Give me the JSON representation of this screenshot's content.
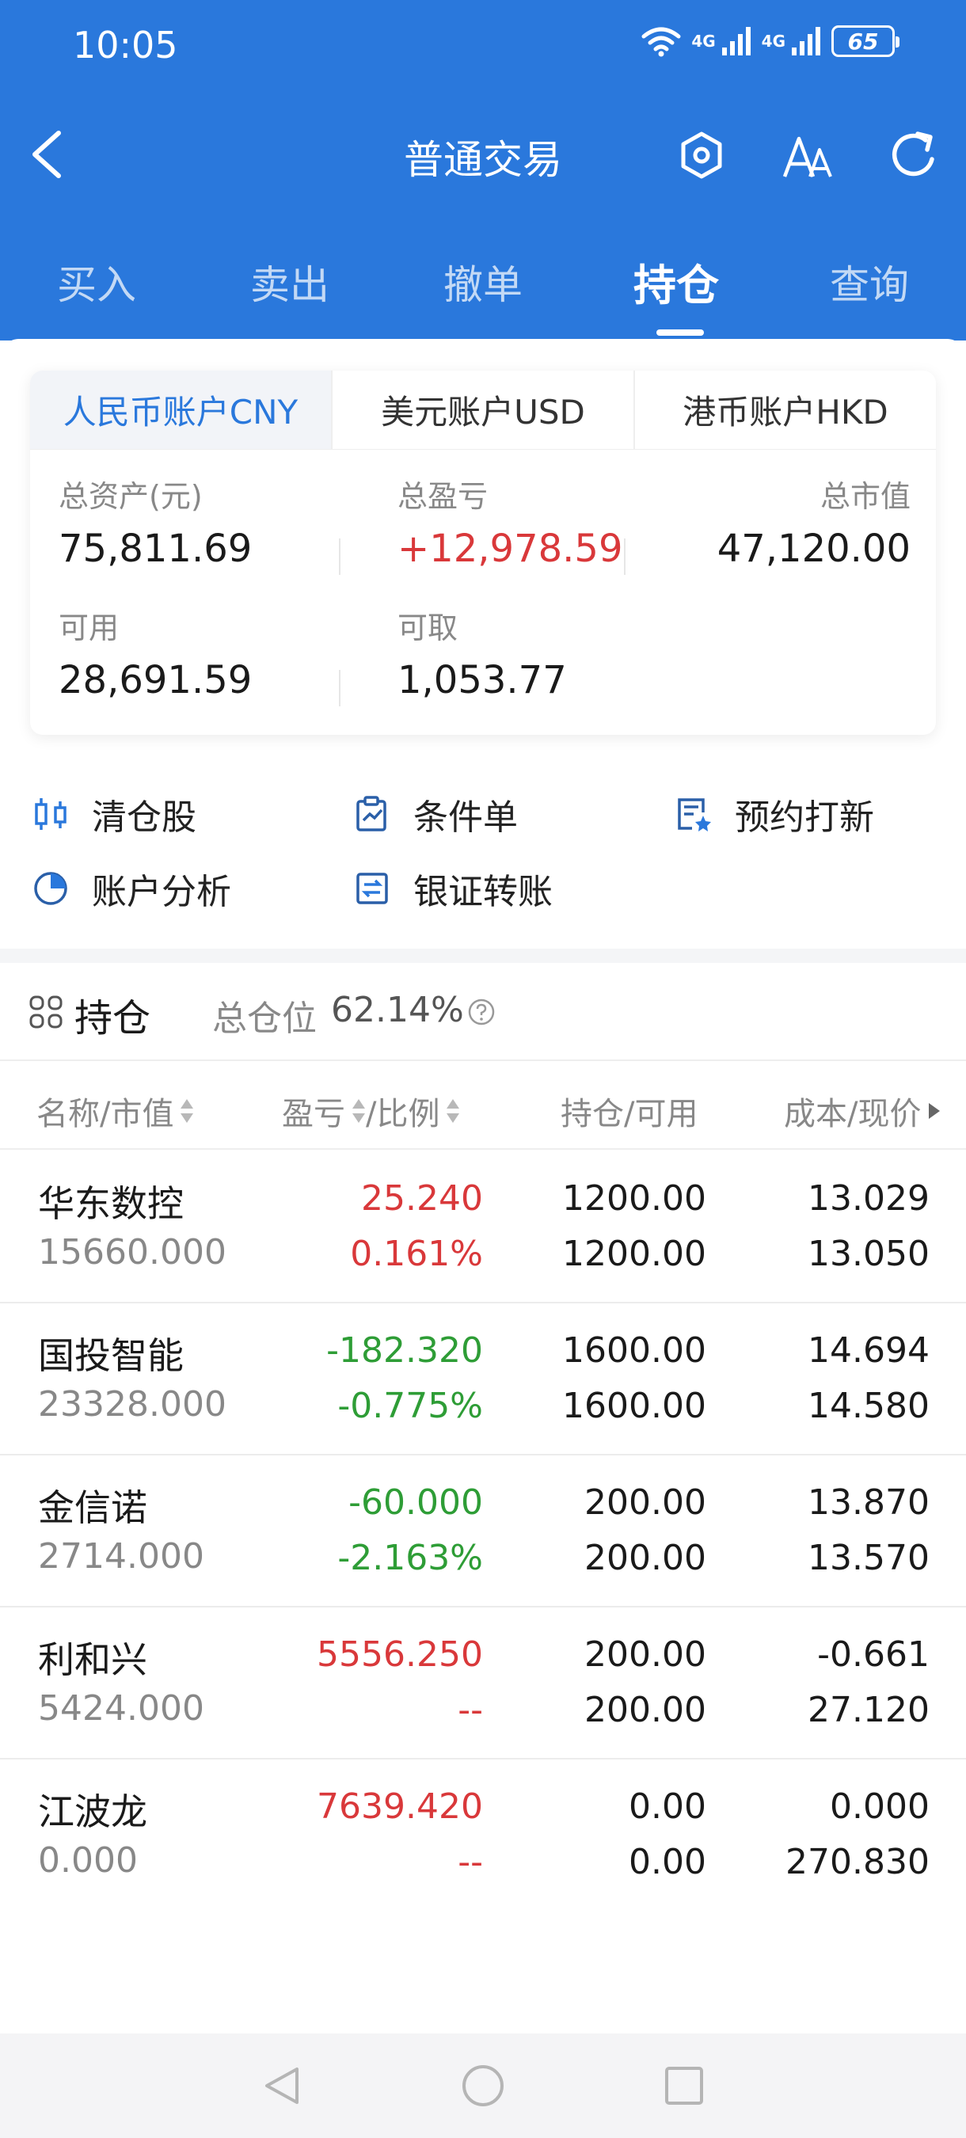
{
  "status_bar": {
    "time": "10:05",
    "network_1": "4G",
    "network_2": "4G",
    "battery": "65",
    "icons": [
      "wifi-icon",
      "signal-icon",
      "signal-icon",
      "battery-icon"
    ]
  },
  "nav": {
    "title": "普通交易",
    "icons": [
      "back-icon",
      "settings-hexagon-icon",
      "font-size-icon",
      "refresh-icon"
    ]
  },
  "tabs": [
    "买入",
    "卖出",
    "撤单",
    "持仓",
    "查询"
  ],
  "active_tab": "持仓",
  "accounts": {
    "tabs": [
      "人民币账户CNY",
      "美元账户USD",
      "港币账户HKD"
    ],
    "active": "人民币账户CNY",
    "total_assets_label": "总资产(元)",
    "total_assets": "75,811.69",
    "total_pl_label": "总盈亏",
    "total_pl": "+12,978.59",
    "market_value_label": "总市值",
    "market_value": "47,120.00",
    "available_label": "可用",
    "available": "28,691.59",
    "withdrawable_label": "可取",
    "withdrawable": "1,053.77"
  },
  "shortcuts": [
    {
      "label": "清仓股",
      "icon": "clear-position-icon"
    },
    {
      "label": "条件单",
      "icon": "conditional-order-icon"
    },
    {
      "label": "预约打新",
      "icon": "ipo-reserve-icon"
    },
    {
      "label": "账户分析",
      "icon": "pie-chart-icon"
    },
    {
      "label": "银证转账",
      "icon": "transfer-icon"
    }
  ],
  "positions": {
    "title": "持仓",
    "ratio_label": "总仓位",
    "ratio": "62.14%",
    "columns": [
      "名称/市值",
      "盈亏",
      "/比例",
      "持仓/可用",
      "成本/现价"
    ],
    "rows": [
      {
        "name": "华东数控",
        "market_value": "15660.000",
        "pl": "25.240",
        "pl_ratio": "0.161%",
        "trend": "up",
        "holding": "1200.00",
        "available": "1200.00",
        "cost": "13.029",
        "price": "13.050"
      },
      {
        "name": "国投智能",
        "market_value": "23328.000",
        "pl": "-182.320",
        "pl_ratio": "-0.775%",
        "trend": "down",
        "holding": "1600.00",
        "available": "1600.00",
        "cost": "14.694",
        "price": "14.580"
      },
      {
        "name": "金信诺",
        "market_value": "2714.000",
        "pl": "-60.000",
        "pl_ratio": "-2.163%",
        "trend": "down",
        "holding": "200.00",
        "available": "200.00",
        "cost": "13.870",
        "price": "13.570"
      },
      {
        "name": "利和兴",
        "market_value": "5424.000",
        "pl": "5556.250",
        "pl_ratio": "--",
        "trend": "up",
        "holding": "200.00",
        "available": "200.00",
        "cost": "-0.661",
        "price": "27.120"
      },
      {
        "name": "江波龙",
        "market_value": "0.000",
        "pl": "7639.420",
        "pl_ratio": "--",
        "trend": "up",
        "holding": "0.00",
        "available": "0.00",
        "cost": "0.000",
        "price": "270.830"
      }
    ]
  },
  "colors": {
    "header_blue": "#2a78dc",
    "up_red": "#d9383a",
    "down_green": "#2e9d36"
  }
}
